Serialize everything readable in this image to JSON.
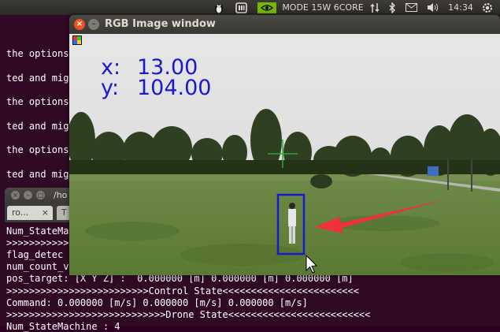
{
  "panel": {
    "power_mode": "MODE 15W 6CORE",
    "time": "14:34",
    "icons": [
      "ubuntu-linux-tux-icon",
      "media-icon",
      "nvidia-icon",
      "network-arrows-icon",
      "mail-icon",
      "volume-icon",
      "power-gear-icon"
    ]
  },
  "terminal": {
    "lines": [
      "the options",
      "ted and mig",
      "the options",
      "ted and mig",
      "the options",
      "ted and mig"
    ]
  },
  "terminal2": {
    "path": "/ho",
    "tabs": [
      "ro...",
      "T"
    ],
    "lines": [
      "Num_StateMa",
      ">>>>>>>>>>>",
      "flag_detec",
      "num_count_v",
      "pos_target: [X Y Z] :  0.000000 [m] 0.000000 [m] 0.000000 [m]",
      ">>>>>>>>>>>>>>>>>>>>>>>>>Control State<<<<<<<<<<<<<<<<<<<<<<<<",
      "Command: 0.000000 [m/s] 0.000000 [m/s] 0.000000 [m/s]",
      ">>>>>>>>>>>>>>>>>>>>>>>>>>>>Drone State<<<<<<<<<<<<<<<<<<<<<<<<<",
      "Num_StateMachine : 4"
    ]
  },
  "image_window": {
    "title": "RGB Image window",
    "x_label": "x:",
    "x_value": "13.00",
    "y_label": "y:",
    "y_value": "104.00",
    "overlay_color": "#1a1acd",
    "crosshair_color": "#2ea82e",
    "arrow_color": "#f0303a"
  }
}
